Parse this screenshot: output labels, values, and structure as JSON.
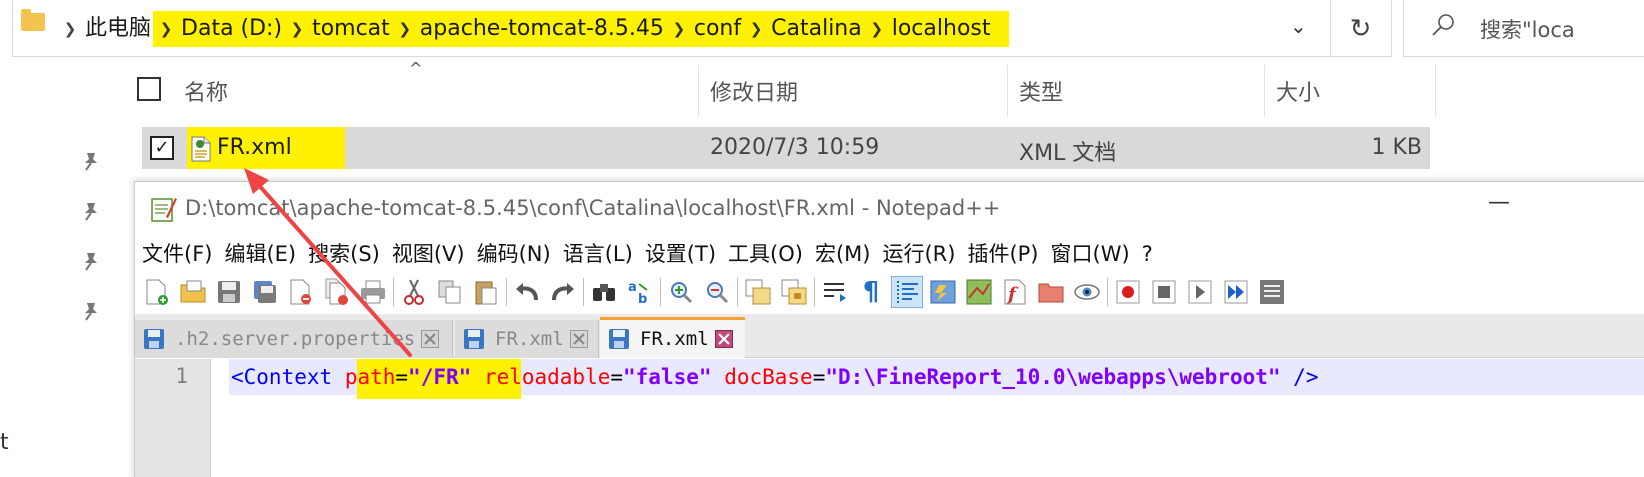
{
  "explorer": {
    "breadcrumb": [
      "此电脑",
      "Data (D:)",
      "tomcat",
      "apache-tomcat-8.5.45",
      "conf",
      "Catalina",
      "localhost"
    ],
    "search_placeholder": "搜索\"loca",
    "columns": {
      "name": "名称",
      "modified": "修改日期",
      "type": "类型",
      "size": "大小"
    },
    "files": [
      {
        "name": "FR.xml",
        "modified": "2020/7/3 10:59",
        "type": "XML 文档",
        "size": "1 KB",
        "checked": true
      }
    ]
  },
  "notepadpp": {
    "title": "D:\\tomcat\\apache-tomcat-8.5.45\\conf\\Catalina\\localhost\\FR.xml - Notepad++",
    "menu": [
      "文件(F)",
      "编辑(E)",
      "搜索(S)",
      "视图(V)",
      "编码(N)",
      "语言(L)",
      "设置(T)",
      "工具(O)",
      "宏(M)",
      "运行(R)",
      "插件(P)",
      "窗口(W)",
      "?"
    ],
    "tabs": [
      {
        "label": ".h2.server.properties",
        "active": false
      },
      {
        "label": "FR.xml",
        "active": false
      },
      {
        "label": "FR.xml",
        "active": true
      }
    ],
    "editor": {
      "line_number": "1",
      "tokens": {
        "open": "<Context",
        "attr1": "path",
        "val1": "\"/FR\"",
        "attr2": "reloadable",
        "val2": "\"false\"",
        "attr3": "docBase",
        "val3": "\"D:\\FineReport_10.0\\webapps\\webroot\"",
        "close": "/>",
        "eq": "="
      }
    }
  },
  "colors": {
    "highlight": "#fff200",
    "arrow": "#ee4444",
    "tab_accent": "#f7a239"
  }
}
